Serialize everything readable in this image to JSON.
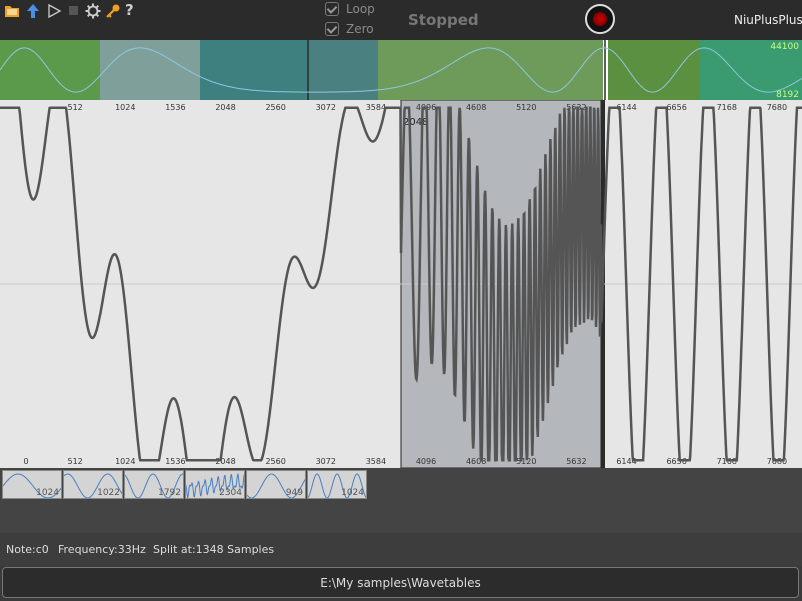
{
  "toolbar": {
    "loop_label": "Loop",
    "zero_label": "Zero",
    "status": "Stopped",
    "app_name": "NiuPlusPlus",
    "help_glyph": "?"
  },
  "overview": {
    "right_top": "44100",
    "right_bottom": "8192"
  },
  "main": {
    "ticks": [
      "0",
      "512",
      "1024",
      "1536",
      "2048",
      "2560",
      "3072",
      "3584",
      "4096",
      "4608",
      "5120",
      "5632",
      "6144",
      "6656",
      "7168",
      "7680"
    ],
    "selection_label": "2048"
  },
  "thumbnails": [
    "1024",
    "1022",
    "1792",
    "2304",
    "949",
    "1024"
  ],
  "info": {
    "note": "Note:c0",
    "frequency": "Frequency:33Hz",
    "split": "Split at:1348 Samples"
  },
  "path": "E:\\My samples\\Wavetables",
  "colors": {
    "accent_green": "#5a9a4a",
    "teal": "#3e7f80",
    "selection": "#b4b8bc",
    "wave": "#555555"
  }
}
